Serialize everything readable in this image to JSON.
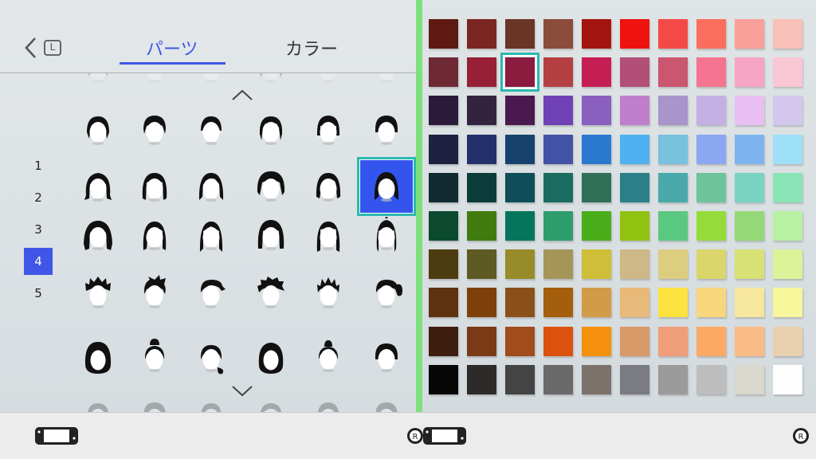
{
  "header": {
    "back_button_key": "L",
    "tabs": [
      {
        "label": "パーツ",
        "active": true
      },
      {
        "label": "カラー",
        "active": false
      }
    ]
  },
  "pages": {
    "items": [
      "1",
      "2",
      "3",
      "4",
      "5"
    ],
    "active": "4"
  },
  "hair_grid": {
    "rows": 5,
    "cols": 6,
    "selected": {
      "row": 1,
      "col": 5
    },
    "styles": [
      [
        "bob-bangs",
        "bob-short",
        "bob-rounded",
        "bob-spiky",
        "bob-pageboy",
        "bob-straight-bangs"
      ],
      [
        "medium-wavy",
        "medium-curl",
        "medium-layered",
        "medium-fluffy",
        "medium-swept",
        "medium-long-selected"
      ],
      [
        "long-wild",
        "long-sidepart",
        "long-middle",
        "long-volume",
        "long-straight",
        "long-tied"
      ],
      [
        "short-spiky-top",
        "short-spiky-side",
        "short-sidecut",
        "short-messy",
        "short-spikes",
        "short-ponytail"
      ],
      [
        "round-clip",
        "bun-top",
        "side-bun",
        "round-pin",
        "topknot",
        "bowl-cut"
      ]
    ]
  },
  "color_palette": {
    "selected": {
      "row": 1,
      "col": 2
    },
    "rows": [
      [
        "#5e1a12",
        "#7b2622",
        "#6a3526",
        "#8a4c3d",
        "#a51510",
        "#ef130f",
        "#f44a46",
        "#fb6e5e",
        "#f9a09a",
        "#f8c0b7"
      ],
      [
        "#6d2a34",
        "#982036",
        "#8b1c3f",
        "#b54044",
        "#c51e55",
        "#b24f77",
        "#cb5670",
        "#f5748f",
        "#f6a6c2",
        "#f9c6d3"
      ],
      [
        "#2b1a3a",
        "#332340",
        "#4a1a4e",
        "#7142b5",
        "#8b5fc0",
        "#c07fcc",
        "#a895cb",
        "#c4b0e2",
        "#e9bff2",
        "#d3c7ee"
      ],
      [
        "#1e2240",
        "#23306a",
        "#17426d",
        "#4252a5",
        "#2a79cf",
        "#4fb1ef",
        "#78c2dd",
        "#8aa7f1",
        "#7db4ef",
        "#9ee0f7"
      ],
      [
        "#102b32",
        "#0a3c3a",
        "#0f4e58",
        "#1a6b60",
        "#2f6e57",
        "#2b7f88",
        "#4aa9ab",
        "#6ec39d",
        "#79d4c1",
        "#89e5b5"
      ],
      [
        "#0c4a30",
        "#407c0d",
        "#05755c",
        "#2d9d6d",
        "#4aae1b",
        "#8fc211",
        "#5bc882",
        "#95dc3b",
        "#93d977",
        "#b9f1a3"
      ],
      [
        "#4d3c10",
        "#5e5a23",
        "#988b29",
        "#a59559",
        "#cfbe37",
        "#cdb886",
        "#ddcd7f",
        "#dbd66b",
        "#d8e173",
        "#dcf39a"
      ],
      [
        "#5e3110",
        "#7e400a",
        "#8a5019",
        "#a45e0c",
        "#d19b48",
        "#e8b978",
        "#fde33f",
        "#f8d67b",
        "#f7e69d",
        "#f8f69a"
      ],
      [
        "#3e1e0f",
        "#7a3a15",
        "#a04c1b",
        "#da520d",
        "#f4900b",
        "#d89a68",
        "#f09e7a",
        "#fbaa65",
        "#fbbb86",
        "#e9d0af"
      ],
      [
        "#060606",
        "#2d2a2a",
        "#444444",
        "#6a6a6a",
        "#7c726b",
        "#7b7b84",
        "#9b9b9b",
        "#bdbdbd",
        "#dad7ce",
        "#fdfdfd"
      ]
    ]
  },
  "footer": {
    "left_icon": "handheld-console-icon",
    "right_icon": "r-stick-button-icon"
  },
  "colors": {
    "accent": "#3f56e6",
    "selection": "#2bb9b0",
    "divider": "#7ee07c"
  }
}
